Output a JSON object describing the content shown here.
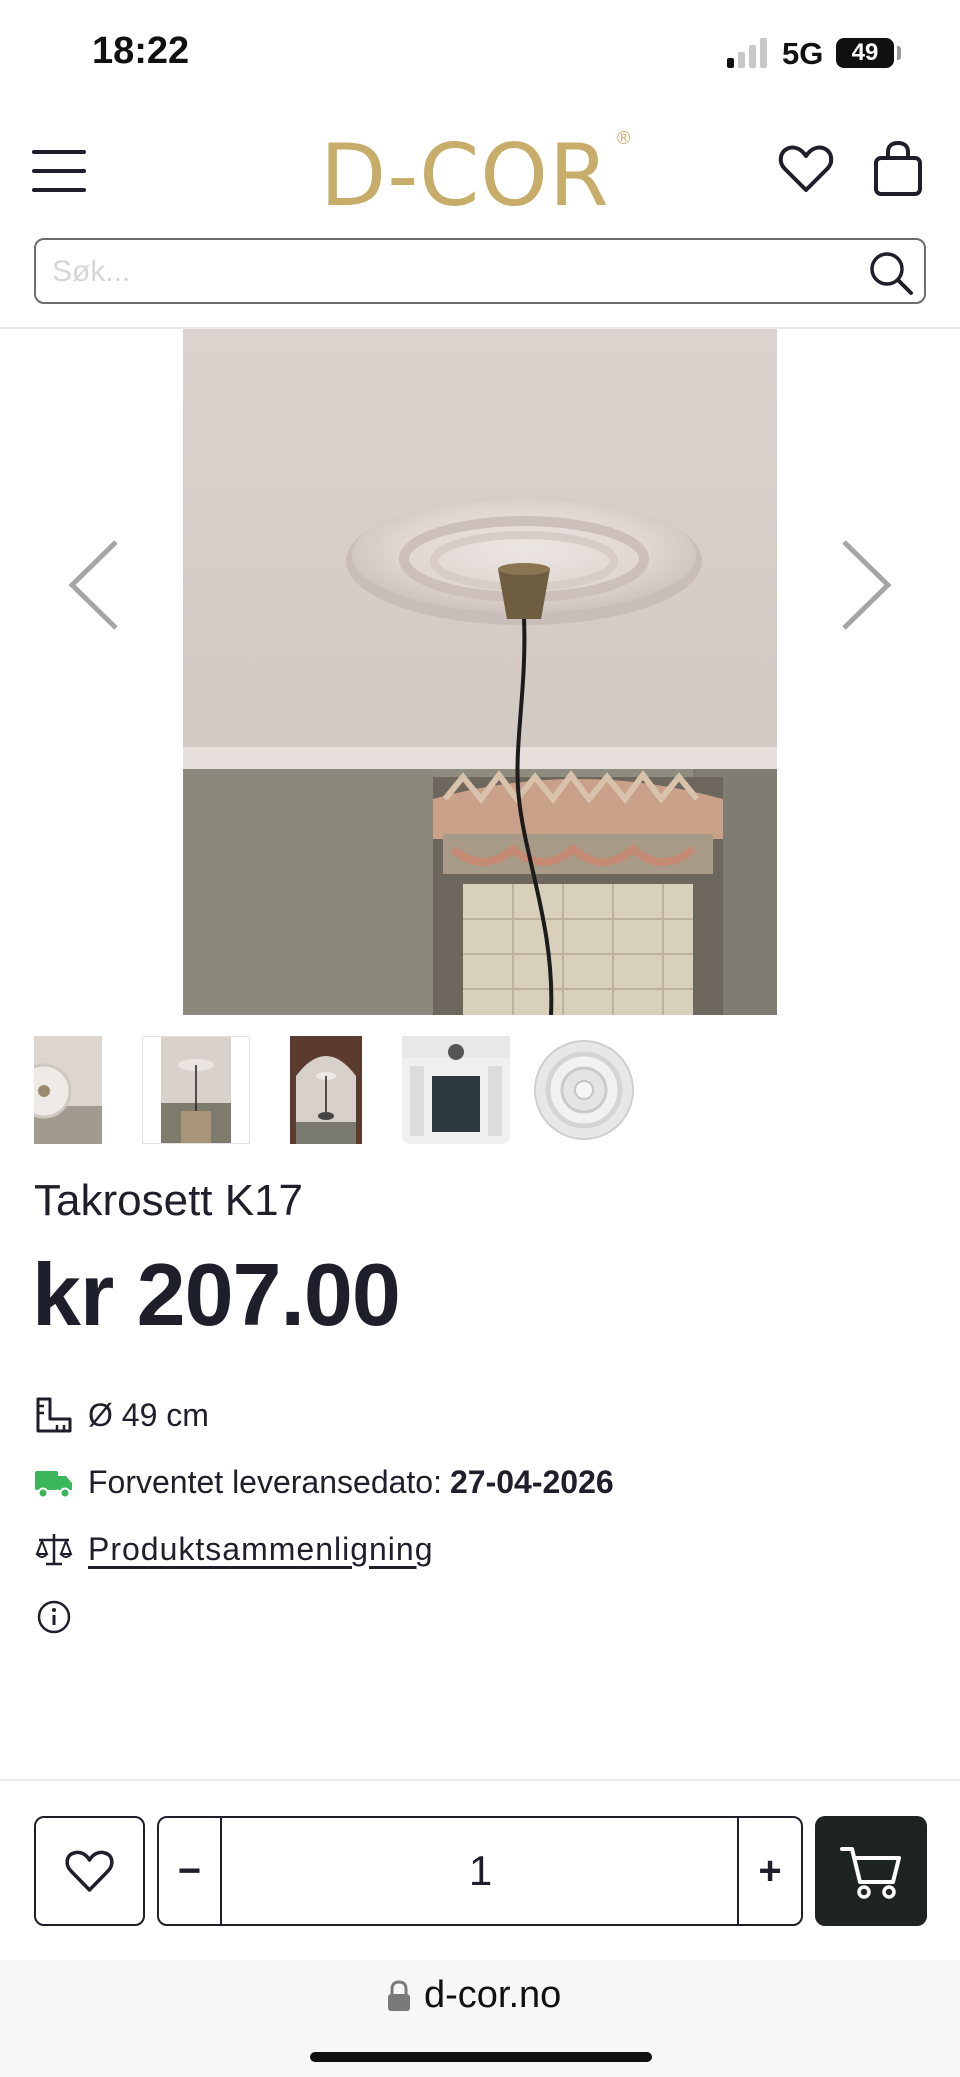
{
  "status_bar": {
    "time": "18:22",
    "network": "5G",
    "battery": "49"
  },
  "header": {
    "logo": "D-COR",
    "logo_mark": "®"
  },
  "search": {
    "placeholder": "Søk..."
  },
  "product": {
    "title": "Takrosett K17",
    "price": "kr 207.00",
    "diameter": "Ø 49 cm",
    "delivery_label": "Forventet leveransedato:",
    "delivery_date": "27-04-2026",
    "compare_link": "Produktsammenligning"
  },
  "cart": {
    "quantity": "1",
    "minus_label": "−",
    "plus_label": "+"
  },
  "browser": {
    "url": "d-cor.no"
  },
  "colors": {
    "brand_gold": "#c8ad6a",
    "text_dark": "#1f1f2b",
    "delivery_green": "#3cb65a",
    "cart_button": "#1e2420"
  }
}
